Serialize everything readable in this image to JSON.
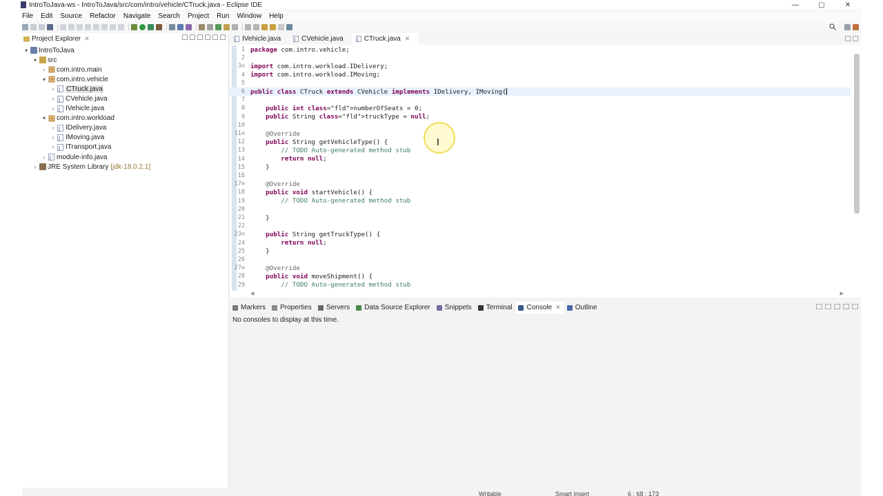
{
  "window": {
    "title": "IntroToJava-ws - IntroToJava/src/com/intro/vehicle/CTruck.java - Eclipse IDE",
    "controls": [
      "—",
      "▢",
      "✕"
    ]
  },
  "menu": [
    "File",
    "Edit",
    "Source",
    "Refactor",
    "Navigate",
    "Search",
    "Project",
    "Run",
    "Window",
    "Help"
  ],
  "explorer": {
    "tab_label": "Project Explorer",
    "tree": [
      {
        "label": "IntroToJava",
        "arrow": "▾",
        "icon": "project-icon",
        "indent": 0
      },
      {
        "label": "src",
        "arrow": "▾",
        "icon": "source-folder-icon",
        "indent": 1
      },
      {
        "label": "com.intro.main",
        "arrow": "›",
        "icon": "package-icon",
        "indent": 2
      },
      {
        "label": "com.intro.vehicle",
        "arrow": "▾",
        "icon": "package-icon",
        "indent": 2
      },
      {
        "label": "CTruck.java",
        "arrow": "›",
        "icon": "java-file-icon",
        "indent": 3,
        "selected": true
      },
      {
        "label": "CVehicle.java",
        "arrow": "›",
        "icon": "java-file-icon",
        "indent": 3
      },
      {
        "label": "IVehicle.java",
        "arrow": "›",
        "icon": "java-file-icon",
        "indent": 3
      },
      {
        "label": "com.intro.workload",
        "arrow": "▾",
        "icon": "package-icon",
        "indent": 2
      },
      {
        "label": "IDelivery.java",
        "arrow": "›",
        "icon": "java-file-icon",
        "indent": 3
      },
      {
        "label": "IMoving.java",
        "arrow": "›",
        "icon": "java-file-icon",
        "indent": 3
      },
      {
        "label": "ITransport.java",
        "arrow": "›",
        "icon": "java-file-icon",
        "indent": 3
      },
      {
        "label": "module-info.java",
        "arrow": "›",
        "icon": "java-file-icon",
        "indent": 2
      },
      {
        "label": "JRE System Library",
        "arrow": "›",
        "icon": "library-icon",
        "indent": 1,
        "decoration": "[jdk-18.0.2.1]"
      }
    ]
  },
  "editor": {
    "tabs": [
      {
        "label": "IVehicle.java",
        "active": false
      },
      {
        "label": "CVehicle.java",
        "active": false
      },
      {
        "label": "CTruck.java",
        "active": true
      }
    ],
    "current_line": 6,
    "lines": [
      {
        "n": "1",
        "code": "package com.intro.vehicle;"
      },
      {
        "n": "2",
        "code": ""
      },
      {
        "n": "3⊖",
        "code": "import com.intro.workload.IDelivery;"
      },
      {
        "n": "4",
        "code": "import com.intro.workload.IMoving;"
      },
      {
        "n": "5",
        "code": ""
      },
      {
        "n": "6",
        "code": "public class CTruck extends CVehicle implements IDelivery, IMoving{"
      },
      {
        "n": "7",
        "code": ""
      },
      {
        "n": "8",
        "code": "    public int numberOfSeats = 0;"
      },
      {
        "n": "9",
        "code": "    public String truckType = null;"
      },
      {
        "n": "10",
        "code": ""
      },
      {
        "n": "11⊖",
        "code": "    @Override"
      },
      {
        "n": "12",
        "code": "    public String getVehicleType() {"
      },
      {
        "n": "13",
        "code": "        // TODO Auto-generated method stub"
      },
      {
        "n": "14",
        "code": "        return null;"
      },
      {
        "n": "15",
        "code": "    }"
      },
      {
        "n": "16",
        "code": ""
      },
      {
        "n": "17⊖",
        "code": "    @Override"
      },
      {
        "n": "18",
        "code": "    public void startVehicle() {"
      },
      {
        "n": "19",
        "code": "        // TODO Auto-generated method stub"
      },
      {
        "n": "20",
        "code": ""
      },
      {
        "n": "21",
        "code": "    }"
      },
      {
        "n": "22",
        "code": ""
      },
      {
        "n": "23⊖",
        "code": "    public String getTruckType() {"
      },
      {
        "n": "24",
        "code": "        return null;"
      },
      {
        "n": "25",
        "code": "    }"
      },
      {
        "n": "26",
        "code": ""
      },
      {
        "n": "27⊖",
        "code": "    @Override"
      },
      {
        "n": "28",
        "code": "    public void moveShipment() {"
      },
      {
        "n": "29",
        "code": "        // TODO Auto-generated method stub"
      }
    ]
  },
  "bottom_panel": {
    "tabs": [
      {
        "label": "Markers",
        "icon": "markers-icon",
        "color": "#7a7a7a",
        "active": false
      },
      {
        "label": "Properties",
        "icon": "properties-icon",
        "color": "#8a8a8a",
        "active": false
      },
      {
        "label": "Servers",
        "icon": "servers-icon",
        "color": "#6a6a6a",
        "active": false
      },
      {
        "label": "Data Source Explorer",
        "icon": "data-source-icon",
        "color": "#4a8a4a",
        "active": false
      },
      {
        "label": "Snippets",
        "icon": "snippets-icon",
        "color": "#7a6a9a",
        "active": false
      },
      {
        "label": "Terminal",
        "icon": "terminal-icon",
        "color": "#333333",
        "active": false
      },
      {
        "label": "Console",
        "icon": "console-icon",
        "color": "#3a5a8a",
        "active": true
      },
      {
        "label": "Outline",
        "icon": "outline-icon",
        "color": "#4a6aaa",
        "active": false
      }
    ],
    "message": "No consoles to display at this time."
  },
  "status": {
    "mode": "Writable",
    "insert": "Smart Insert",
    "position": "6 : 68 : 173"
  },
  "colors": {
    "keyword": "#7f0055",
    "comment": "#3f7f5f",
    "annotation": "#646464",
    "field": "#0000c0",
    "current_line": "#e8f2fe"
  }
}
